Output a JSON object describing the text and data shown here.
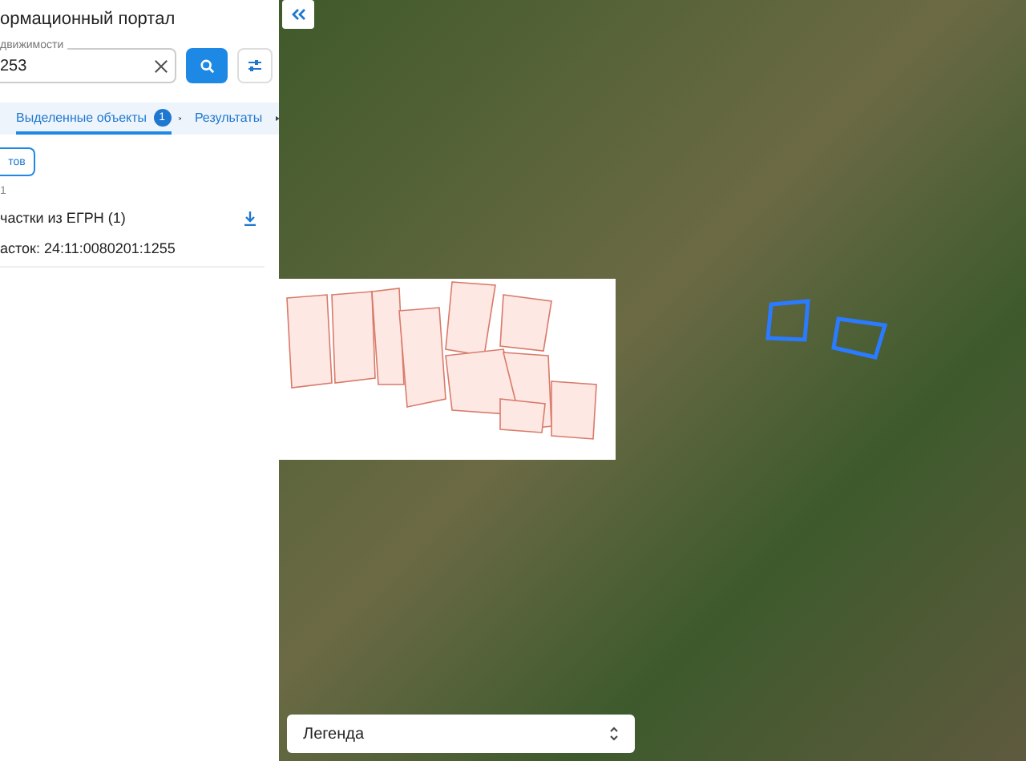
{
  "header": {
    "title": "ормационный портал"
  },
  "search": {
    "label": "движимости",
    "value": "253"
  },
  "tabs": [
    {
      "label": "Выделенные объекты",
      "badge": "1",
      "closable": true,
      "selected": true
    },
    {
      "label": "Результаты",
      "closable": false,
      "selected": false
    }
  ],
  "panel": {
    "button": "тов",
    "count": "1",
    "group": "частки из ЕГРН (1)",
    "item": "асток: 24:11:0080201:1255"
  },
  "map": {
    "legend": "Легенда"
  }
}
